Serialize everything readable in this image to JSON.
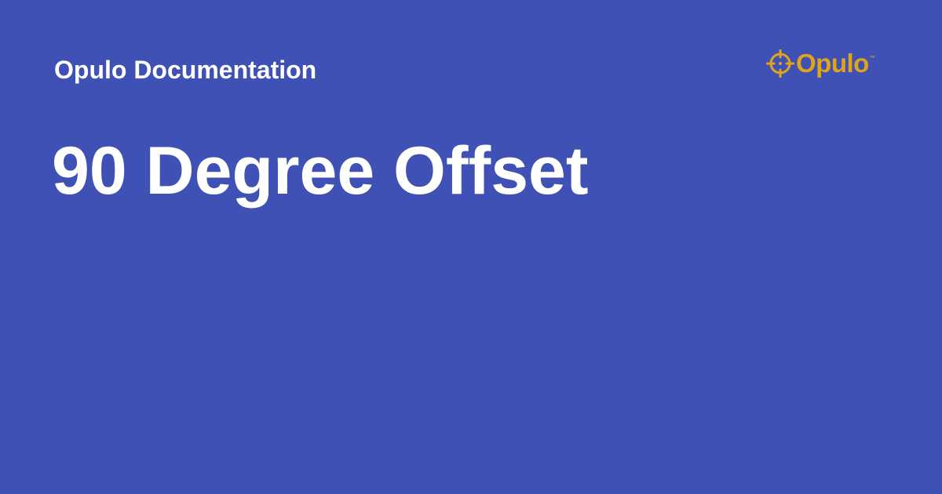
{
  "header": {
    "site_title": "Opulo Documentation"
  },
  "main": {
    "page_title": "90 Degree Offset"
  },
  "logo": {
    "icon": "crosshair-icon",
    "wordmark": "Opulo",
    "trademark": "™",
    "color": "#e0a31c"
  },
  "theme": {
    "background": "#3f51b5",
    "text": "#ffffff"
  }
}
